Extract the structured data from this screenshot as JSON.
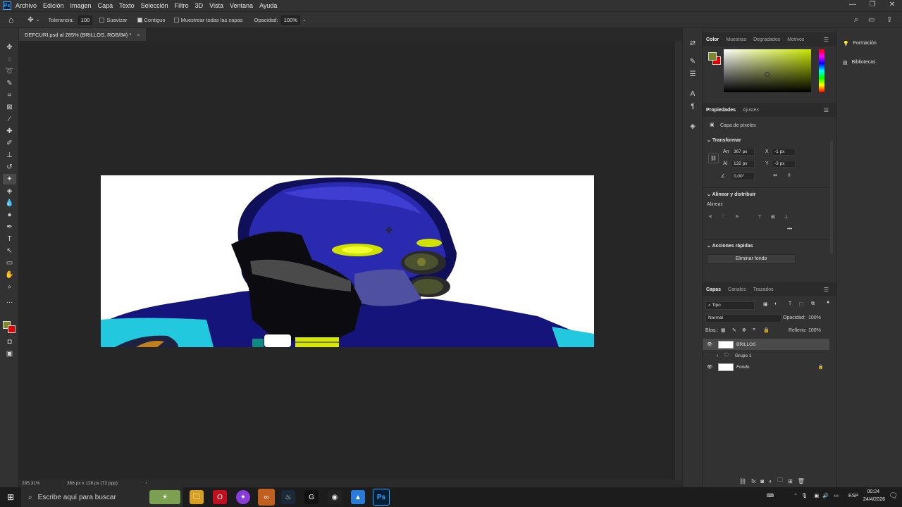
{
  "menubar": {
    "items": [
      "Archivo",
      "Edición",
      "Imagen",
      "Capa",
      "Texto",
      "Selección",
      "Filtro",
      "3D",
      "Vista",
      "Ventana",
      "Ayuda"
    ],
    "window_controls": [
      "—",
      "❐",
      "✕"
    ]
  },
  "options": {
    "tolerance_label": "Tolerancia:",
    "tolerance_value": "100",
    "smooth_label": "Suavizar",
    "contiguous_label": "Contiguo",
    "sample_all_label": "Muestrear todas las capas",
    "opacity_label": "Opacidad:",
    "opacity_value": "100%"
  },
  "document": {
    "tab_title": "DEFCURI.psd al 285% (BRILLOS, RGB/8#) *",
    "zoom": "285,31%",
    "doc_size": "368 px x 128 px (72 ppp)"
  },
  "color_panel": {
    "tabs": [
      "Color",
      "Muestras",
      "Degradados",
      "Motivos"
    ],
    "foreground": "#7a8a2a",
    "background": "#e00000",
    "hue_color": "#c8e600"
  },
  "properties": {
    "tabs": [
      "Propiedades",
      "Ajustes"
    ],
    "layer_type": "Capa de píxeles",
    "transform_title": "Transformar",
    "w_label": "An",
    "w_value": "367 px",
    "x_label": "X",
    "x_value": "-1 px",
    "h_label": "Al",
    "h_value": "132 px",
    "y_label": "Y",
    "y_value": "-3 px",
    "angle_value": "0,00°",
    "align_title": "Alinear y distribuir",
    "align_label": "Alinear:",
    "quick_title": "Acciones rápidas",
    "remove_bg": "Eliminar fondo"
  },
  "layers": {
    "tabs": [
      "Capas",
      "Canales",
      "Trazados"
    ],
    "filter_kind": "Tipo",
    "blend_mode": "Normal",
    "opacity_label": "Opacidad:",
    "opacity_value": "100%",
    "lock_label": "Bloq.:",
    "fill_label": "Relleno:",
    "fill_value": "100%",
    "items": [
      {
        "name": "BRILLOS",
        "visible": true,
        "selected": true
      },
      {
        "name": "Grupo 1",
        "visible": false,
        "selected": false
      },
      {
        "name": "Fondo",
        "visible": true,
        "selected": false,
        "locked": true
      }
    ]
  },
  "right_panel": {
    "items": [
      "Formación",
      "Bibliotecas"
    ]
  },
  "taskbar": {
    "search_placeholder": "Escribe aquí para buscar",
    "language": "ESP",
    "time": "00:24",
    "date": "24/4/2026"
  }
}
